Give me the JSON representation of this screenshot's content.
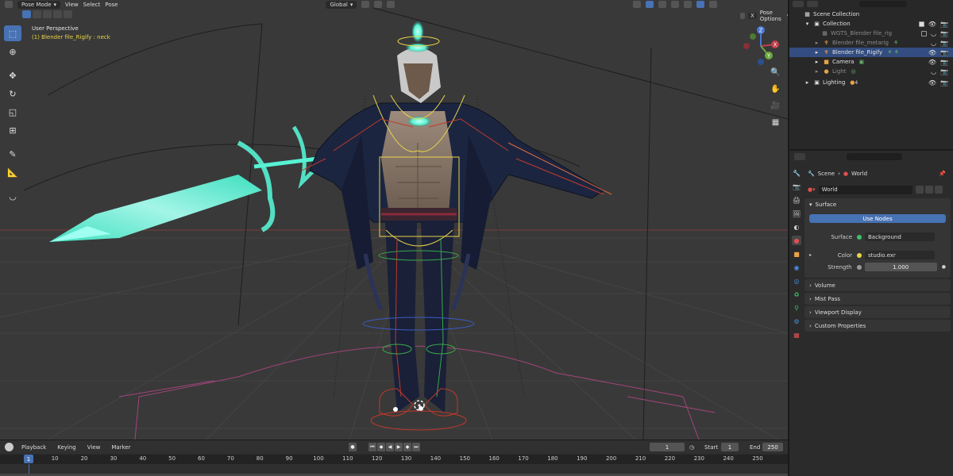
{
  "viewport": {
    "mode": "Pose Mode",
    "menus": [
      "View",
      "Select",
      "Pose"
    ],
    "transform_orientation": "Global",
    "perspective": "User Perspective",
    "active_object": "(1) Blender file_Rigify : neck",
    "options_label": "Pose Options",
    "x_label": "X",
    "gizmo_axes": [
      "Z",
      "X",
      "Y"
    ]
  },
  "toolbar": {
    "tools": [
      "select-box",
      "cursor",
      "move",
      "rotate",
      "scale",
      "transform",
      "annotate",
      "measure",
      "relax-pose"
    ]
  },
  "outliner": {
    "root": "Scene Collection",
    "collection": "Collection",
    "items": [
      {
        "name": "WGTS_Blender file_rig",
        "dim": true
      },
      {
        "name": "Blender file_metarig",
        "dim": true
      },
      {
        "name": "Blender file_Rigify",
        "dim": false
      },
      {
        "name": "Camera",
        "dim": false
      },
      {
        "name": "Light",
        "dim": true
      }
    ],
    "lighting": "Lighting",
    "lighting_count": "4"
  },
  "properties": {
    "breadcrumb_scene": "Scene",
    "breadcrumb_world": "World",
    "world_name": "World",
    "surface_panel": "Surface",
    "use_nodes": "Use Nodes",
    "surface_label": "Surface",
    "surface_value": "Background",
    "color_label": "Color",
    "color_value": "studio.exr",
    "strength_label": "Strength",
    "strength_value": "1.000",
    "collapsed_panels": [
      "Volume",
      "Mist Pass",
      "Viewport Display",
      "Custom Properties"
    ]
  },
  "timeline": {
    "menus": [
      "Playback",
      "Keying",
      "View",
      "Marker"
    ],
    "current_frame": "1",
    "start_label": "Start",
    "start_value": "1",
    "end_label": "End",
    "end_value": "250",
    "ruler_current": "1",
    "ruler_ticks": [
      "10",
      "20",
      "30",
      "40",
      "50",
      "60",
      "70",
      "80",
      "90",
      "100",
      "110",
      "120",
      "130",
      "140",
      "150",
      "160",
      "170",
      "180",
      "190",
      "200",
      "210",
      "220",
      "230",
      "240",
      "250"
    ]
  },
  "colors": {
    "accent": "#4772b3",
    "selection_yellow": "#e8d44a",
    "bone_green": "#3aa84a",
    "bone_red": "#c0392b",
    "glow": "#56f2d4"
  }
}
